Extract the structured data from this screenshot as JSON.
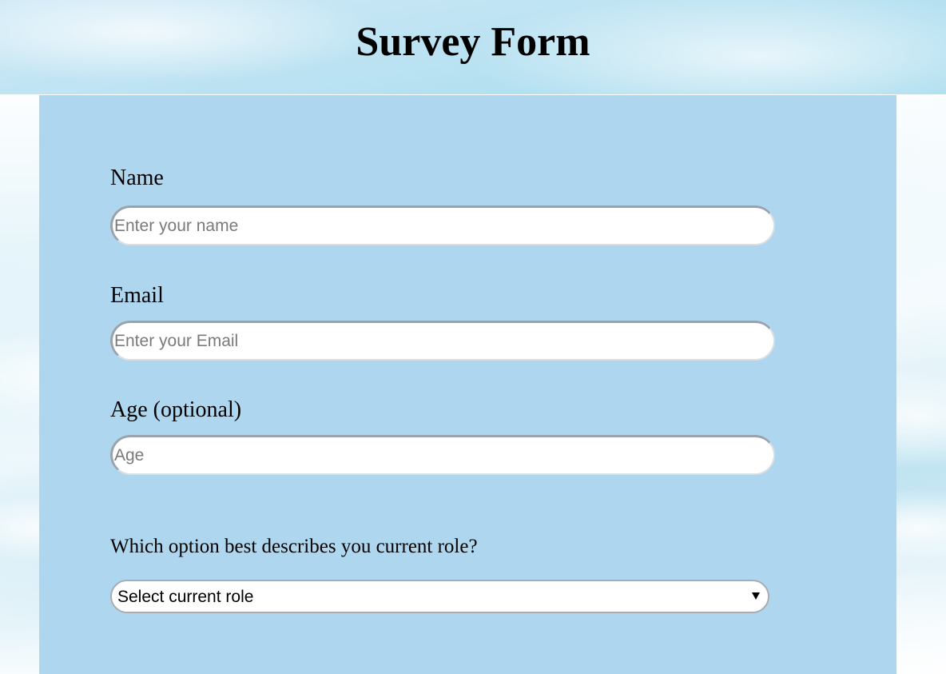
{
  "page": {
    "title": "Survey Form"
  },
  "form": {
    "name": {
      "label": "Name",
      "placeholder": "Enter your name",
      "value": ""
    },
    "email": {
      "label": "Email",
      "placeholder": "Enter your Email",
      "value": ""
    },
    "age": {
      "label": "Age (optional)",
      "placeholder": "Age",
      "value": ""
    },
    "role": {
      "question": "Which option best describes you current role?",
      "selected": "Select current role"
    }
  },
  "colors": {
    "card_background": "#aed6ef",
    "input_background": "#ffffff",
    "text": "#000000"
  },
  "icons": {
    "select_arrow": "chevron-down-icon"
  }
}
